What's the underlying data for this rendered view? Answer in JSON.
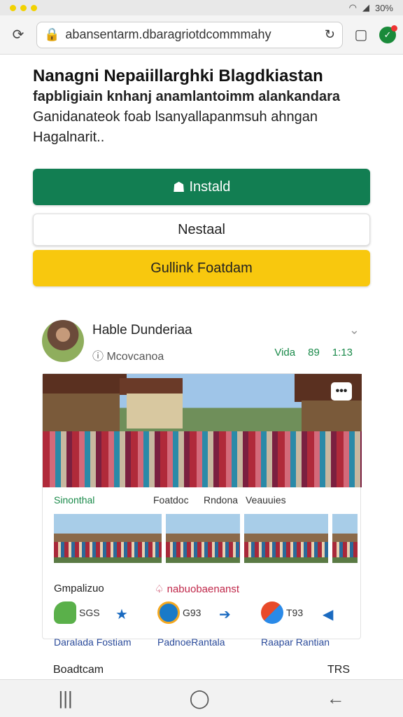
{
  "status": {
    "battery": "30%"
  },
  "browser": {
    "url": "abansentarm.dbaragriotdcommmahy"
  },
  "page": {
    "headline": "Nanagni Nepaiillarghki Blagdkiastan",
    "line2": "fapbligiain knhanj anamlantoimm alankandara",
    "line3": "Ganidanateok foab lsanyallapanmsuh ahngan",
    "line4": "Hagalnarit..",
    "install_label": "Instald",
    "second_label": "Nestaal",
    "yellow_label": "Gullink Foatdam"
  },
  "card": {
    "title": "Hable Dunderiaa",
    "subtitle": "Mcovcanoa",
    "meta": [
      "Vida",
      "89",
      "1:13"
    ],
    "photo_labels": [
      "Sinonthal",
      "Foatdoc",
      "Rndona",
      "Veauuies"
    ],
    "section_title": "Gmpalizuo",
    "section_badge": "nabuobaenanst",
    "apps": [
      {
        "value": "SGS",
        "name": "Daralada Fostiam",
        "color": "#4aa84a"
      },
      {
        "value": "G93",
        "name": "PadnoeRantala",
        "color": "#1a7ac8"
      },
      {
        "value": "T93",
        "name": "Raapar Rantian",
        "color": "#e84a2a"
      }
    ]
  },
  "bottom": {
    "left": "Boadtcam",
    "right": "TRS"
  }
}
